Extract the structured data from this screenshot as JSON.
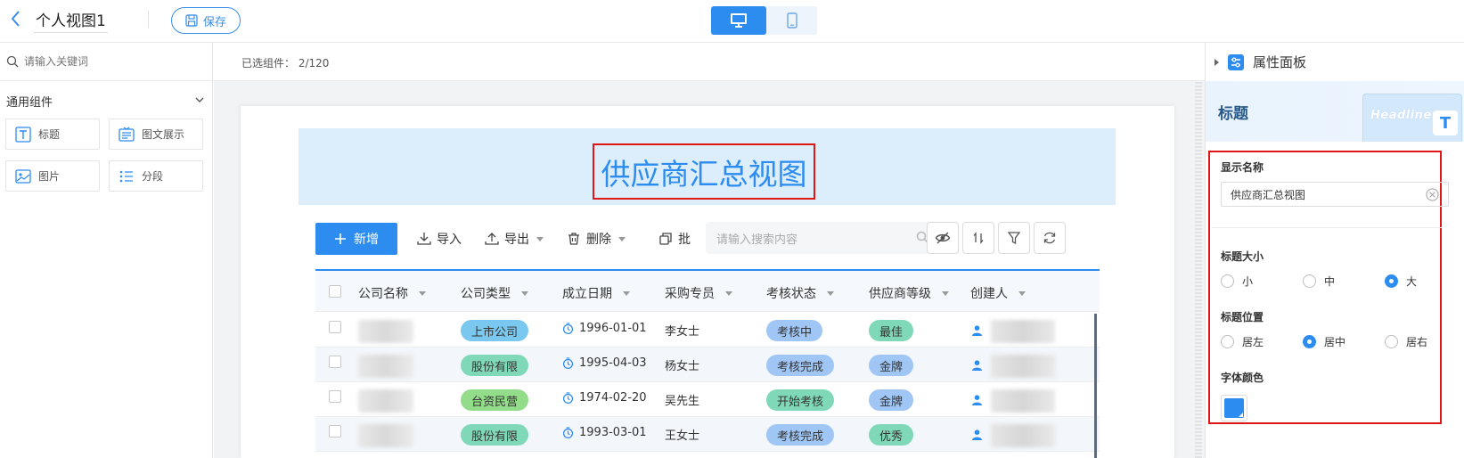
{
  "header": {
    "view_title": "个人视图1",
    "save_label": "保存"
  },
  "sidebar": {
    "search_placeholder": "请输入关键词",
    "group_title": "通用组件",
    "components": [
      {
        "label": "标题",
        "icon": "title-icon"
      },
      {
        "label": "图文展示",
        "icon": "image-text-icon"
      },
      {
        "label": "图片",
        "icon": "image-icon"
      },
      {
        "label": "分段",
        "icon": "list-icon"
      }
    ]
  },
  "canvas": {
    "selected_info": "已选组件：  2/120",
    "page_title": "供应商汇总视图",
    "toolbar": {
      "add_label": "新增",
      "import_label": "导入",
      "export_label": "导出",
      "delete_label": "删除",
      "batch_label": "批",
      "search_placeholder": "请输入搜索内容"
    },
    "table": {
      "headers": [
        "公司名称",
        "公司类型",
        "成立日期",
        "采购专员",
        "考核状态",
        "供应商等级",
        "创建人"
      ],
      "rows": [
        {
          "type": "上市公司",
          "date": "1996-01-01",
          "buyer": "李女士",
          "status": "考核中",
          "level": "最佳"
        },
        {
          "type": "股份有限",
          "date": "1995-04-03",
          "buyer": "杨女士",
          "status": "考核完成",
          "level": "金牌"
        },
        {
          "type": "台资民营",
          "date": "1974-02-20",
          "buyer": "吴先生",
          "status": "开始考核",
          "level": "金牌"
        },
        {
          "type": "股份有限",
          "date": "1993-03-01",
          "buyer": "王女士",
          "status": "考核完成",
          "level": "优秀"
        }
      ]
    }
  },
  "panel": {
    "title": "属性面板",
    "component_name": "标题",
    "banner_word": "Headline",
    "display_name_label": "显示名称",
    "display_name_value": "供应商汇总视图",
    "size_label": "标题大小",
    "size_options": [
      "小",
      "中",
      "大"
    ],
    "size_selected": "大",
    "position_label": "标题位置",
    "position_options": [
      "居左",
      "居中",
      "居右"
    ],
    "position_selected": "居中",
    "font_color_label": "字体颜色",
    "font_color": "#2c8cf0"
  },
  "colors": {
    "accent": "#2c8cf0",
    "highlight": "#e01515",
    "tag_type_blue": "#7ac8ef",
    "tag_type_green": "#7fd9b8",
    "tag_type_lime": "#93dd8a",
    "tag_status": "#9fc6f5",
    "tag_level": "#7fd9b8"
  }
}
